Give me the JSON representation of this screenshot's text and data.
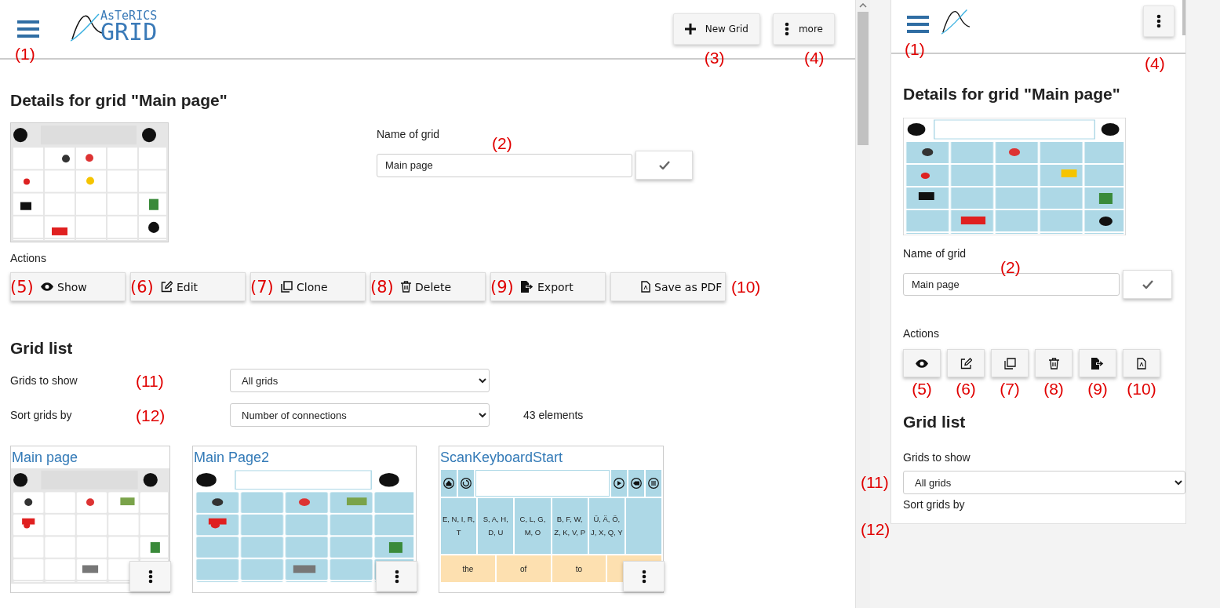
{
  "left": {
    "header": {
      "logo": [
        "AsTeRICS",
        "GRID"
      ],
      "menu_marker": "(1)",
      "buttons": [
        {
          "kind": "new",
          "label": "New Grid",
          "marker": "(3)"
        },
        {
          "kind": "more",
          "label": "more",
          "marker": "(4)"
        }
      ]
    },
    "details": {
      "title": "Details for grid \"Main page\"",
      "name_label": "Name of grid",
      "name_value": "Main page",
      "name_marker": "(2)",
      "actions_label": "Actions",
      "actions": [
        {
          "kind": "show",
          "label": "Show",
          "marker": "(5)"
        },
        {
          "kind": "edit",
          "label": "Edit",
          "marker": "(6)"
        },
        {
          "kind": "clone",
          "label": "Clone",
          "marker": "(7)"
        },
        {
          "kind": "delete",
          "label": "Delete",
          "marker": "(8)"
        },
        {
          "kind": "export",
          "label": "Export",
          "marker": "(9)"
        },
        {
          "kind": "pdf",
          "label": "Save as PDF",
          "marker": "(10)"
        }
      ]
    },
    "grid_list": {
      "title": "Grid list",
      "count": "43 elements",
      "filters": [
        {
          "label": "Grids to show",
          "marker": "(11)",
          "value": "All grids"
        },
        {
          "label": "Sort grids by",
          "marker": "(12)",
          "value": "Number of connections"
        }
      ],
      "cards": [
        {
          "title": "Main page",
          "kind": "white"
        },
        {
          "title": "Main Page2",
          "kind": "blue"
        },
        {
          "title": "ScanKeyboardStart",
          "kind": "keyboard",
          "letter_cells": [
            "E, N, I, R, T",
            "S, A, H, D, U",
            "C, L, G, M, O",
            "B, F, W, Z, K, V, P",
            "Ü, Ä, Ö, J, X, Q, Y"
          ],
          "word_cells": [
            "the",
            "of",
            "to"
          ]
        }
      ]
    }
  },
  "right": {
    "header": {
      "menu_marker": "(1)",
      "more_marker": "(4)"
    },
    "details": {
      "title": "Details for grid \"Main page\"",
      "name_label": "Name of grid",
      "name_value": "Main page",
      "name_marker": "(2)",
      "actions_label": "Actions",
      "actions": [
        {
          "kind": "show",
          "marker": "(5)"
        },
        {
          "kind": "edit",
          "marker": "(6)"
        },
        {
          "kind": "clone",
          "marker": "(7)"
        },
        {
          "kind": "delete",
          "marker": "(8)"
        },
        {
          "kind": "export",
          "marker": "(9)"
        },
        {
          "kind": "pdf",
          "marker": "(10)"
        }
      ]
    },
    "grid_list": {
      "title": "Grid list",
      "filters": [
        {
          "label": "Grids to show",
          "marker": "(11)",
          "value": "All grids"
        },
        {
          "label": "Sort grids by",
          "marker": "(12)"
        }
      ]
    }
  }
}
